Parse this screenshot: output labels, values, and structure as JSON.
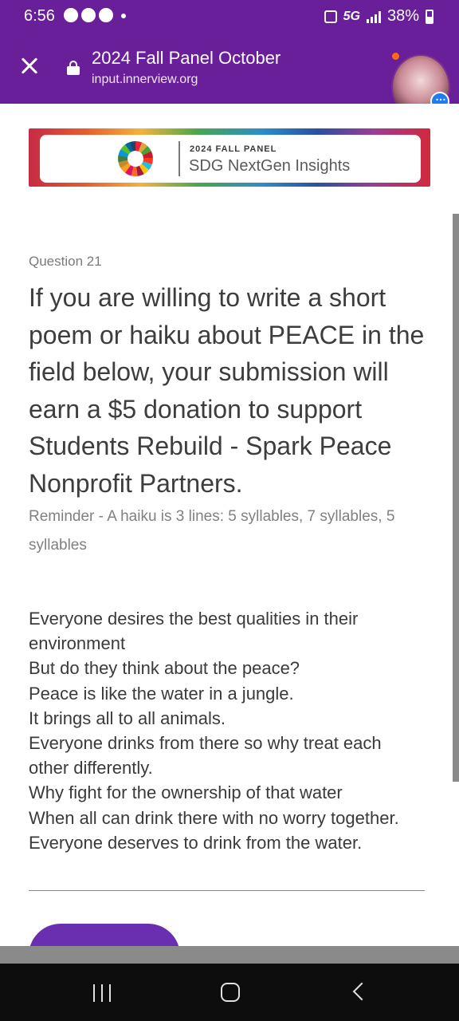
{
  "status_bar": {
    "time": "6:56",
    "network": "5G",
    "battery": "38%"
  },
  "browser": {
    "page_title": "2024 Fall Panel October",
    "url": "input.innerview.org"
  },
  "banner": {
    "kicker": "2024 FALL PANEL",
    "brand": "SDG NextGen Insights"
  },
  "question": {
    "number": "Question 21",
    "text": "If you are willing to write a short poem or haiku about PEACE in the field below, your submission will earn a $5 donation to support Students Rebuild - Spark Peace Nonprofit Partners.",
    "hint": "Reminder - A haiku is 3 lines: 5 syllables, 7 syllables, 5 syllables"
  },
  "answer": {
    "value": "Everyone desires the best qualities in their environment\nBut do they think about the peace?\nPeace is like the water in a jungle.\nIt brings all to all animals.\nEveryone drinks from there so why treat each other differently.\nWhy fight for the ownership of that water\nWhen all can drink there with no worry together.\nEveryone deserves to drink from the water."
  },
  "colors": {
    "header": "#6a1f9a",
    "button": "#6a2fb0"
  },
  "icons": {
    "close": "close-icon",
    "lock": "lock-icon",
    "nav_recent": "recent-apps-icon",
    "nav_home": "home-icon",
    "nav_back": "back-icon"
  }
}
